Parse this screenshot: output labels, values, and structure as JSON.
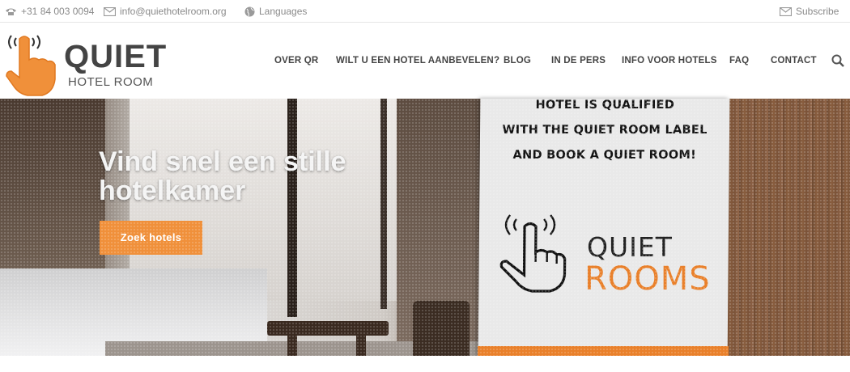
{
  "topbar": {
    "phone": "+31 84 003 0094",
    "email": "info@quiethotelroom.org",
    "languages": "Languages",
    "subscribe": "Subscribe",
    "icon_color": "#9a9a9a"
  },
  "logo": {
    "word": "QUIET",
    "sub": "HOTEL ROOM",
    "hand_color": "#f0903a"
  },
  "nav": {
    "items": [
      "OVER QR",
      "WILT U EEN HOTEL AANBEVELEN?",
      "BLOG",
      "IN DE PERS",
      "INFO VOOR HOTELS",
      "FAQ",
      "CONTACT"
    ],
    "search_icon": "search-icon"
  },
  "hero": {
    "title": "Vind snel een stille hotelkamer",
    "cta": "Zoek hotels",
    "cta_color": "#f0903a",
    "sign_lines": [
      "HOTEL IS QUALIFIED",
      "WITH THE QUIET ROOM LABEL",
      "AND BOOK A QUIET ROOM!"
    ],
    "sign_quiet": "QUIET",
    "sign_rooms": "ROOMS",
    "sign_accent": "#e9802a"
  }
}
